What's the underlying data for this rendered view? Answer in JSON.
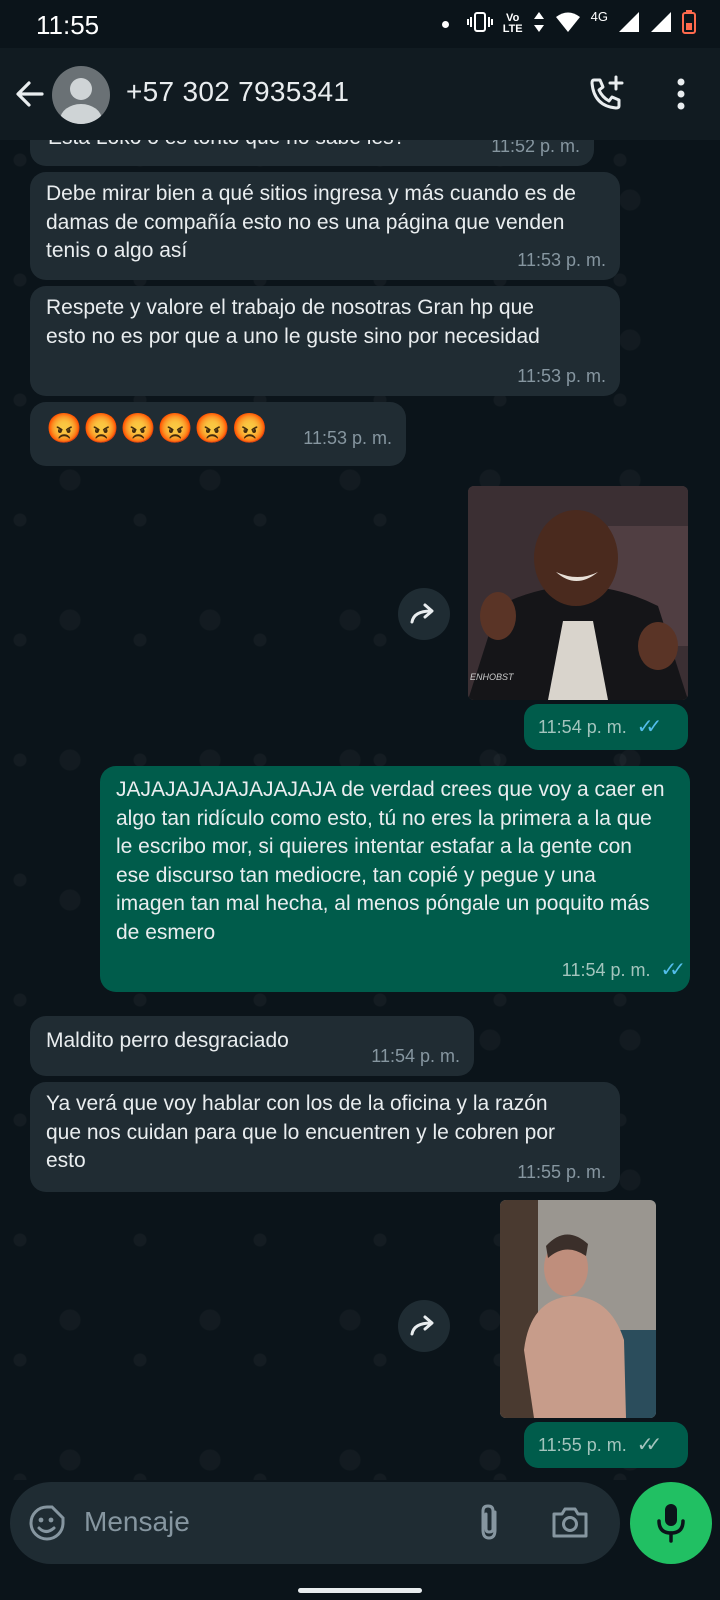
{
  "status": {
    "time": "11:55",
    "volte_top": "Vo",
    "volte_bottom": "LTE",
    "network": "4G"
  },
  "header": {
    "contact": "+57 302 7935341"
  },
  "messages": [
    {
      "type": "text",
      "direction": "in",
      "text": "Esta Loko o es tonto que no sabe les?",
      "time": "11:52 p. m."
    },
    {
      "type": "text",
      "direction": "in",
      "text": "Debe mirar bien a qué sitios ingresa y más cuando es de damas de compañía esto no es una página que venden tenis o algo así",
      "time": "11:53 p. m."
    },
    {
      "type": "text",
      "direction": "in",
      "text": "Respete y valore el trabajo de nosotras Gran hp que esto no es por que a uno le guste sino por necesidad",
      "time": "11:53 p. m."
    },
    {
      "type": "text",
      "direction": "in",
      "text": "😡😡😡😡😡😡",
      "time": "11:53 p. m."
    },
    {
      "type": "image",
      "direction": "out",
      "caption": "ENHOBST",
      "time": "11:54 p. m.",
      "status": "read"
    },
    {
      "type": "text",
      "direction": "out",
      "text": "JAJAJAJAJAJAJAJAJA de verdad crees que voy a caer en algo tan ridículo como esto, tú no eres la primera a la que le escribo mor, si quieres intentar estafar a la gente con ese discurso tan mediocre, tan copié y pegue y una imagen tan mal hecha, al menos póngale un poquito más de esmero",
      "time": "11:54 p. m.",
      "status": "read"
    },
    {
      "type": "text",
      "direction": "in",
      "text": "Maldito perro desgraciado",
      "time": "11:54 p. m."
    },
    {
      "type": "text",
      "direction": "in",
      "text": "Ya verá que voy hablar con los de la oficina y la razón que nos cuidan para que lo encuentren y le cobren por esto",
      "time": "11:55 p. m."
    },
    {
      "type": "image",
      "direction": "out",
      "time": "11:55 p. m.",
      "status": "delivered"
    }
  ],
  "input": {
    "placeholder": "Mensaje"
  },
  "colors": {
    "background": "#0b141a",
    "incoming": "#202c33",
    "outgoing": "#005c4b",
    "read_ticks": "#53bdeb",
    "mic_button": "#21c063"
  }
}
